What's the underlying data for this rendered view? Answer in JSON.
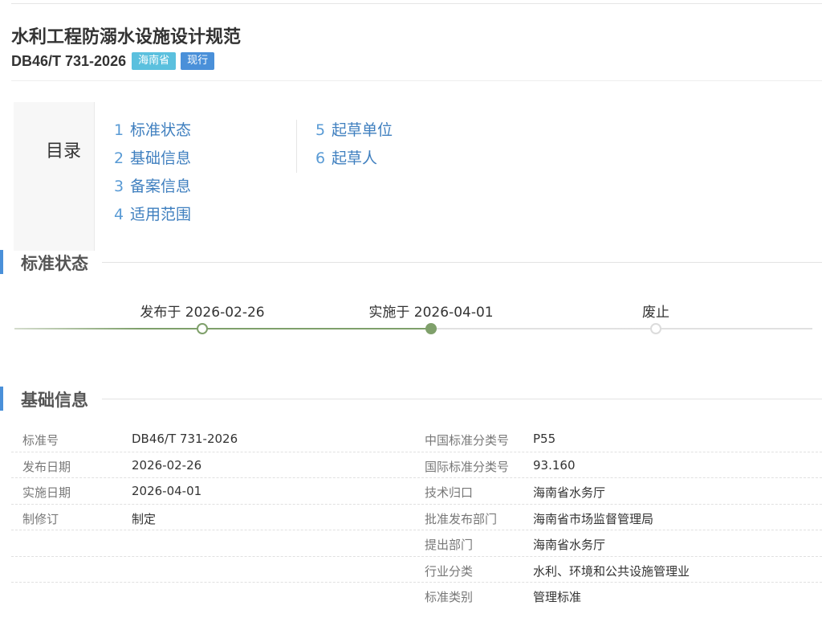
{
  "header": {
    "title": "水利工程防溺水设施设计规范",
    "code": "DB46/T 731-2026",
    "badges": {
      "region": "海南省",
      "status": "现行"
    }
  },
  "toc": {
    "label": "目录",
    "items": [
      {
        "num": "1",
        "label": "标准状态"
      },
      {
        "num": "2",
        "label": "基础信息"
      },
      {
        "num": "3",
        "label": "备案信息"
      },
      {
        "num": "4",
        "label": "适用范围"
      },
      {
        "num": "5",
        "label": "起草单位"
      },
      {
        "num": "6",
        "label": "起草人"
      }
    ]
  },
  "status_section": {
    "title": "标准状态",
    "timeline": [
      {
        "label": "发布于 2026-02-26",
        "state": "passed"
      },
      {
        "label": "实施于 2026-04-01",
        "state": "current"
      },
      {
        "label": "废止",
        "state": "pending"
      }
    ]
  },
  "basic_section": {
    "title": "基础信息",
    "left": [
      {
        "label": "标准号",
        "value": "DB46/T 731-2026"
      },
      {
        "label": "发布日期",
        "value": "2026-02-26"
      },
      {
        "label": "实施日期",
        "value": "2026-04-01"
      },
      {
        "label": "制修订",
        "value": "制定"
      }
    ],
    "right": [
      {
        "label": "中国标准分类号",
        "value": "P55"
      },
      {
        "label": "国际标准分类号",
        "value": "93.160"
      },
      {
        "label": "技术归口",
        "value": "海南省水务厅"
      },
      {
        "label": "批准发布部门",
        "value": "海南省市场监督管理局"
      },
      {
        "label": "提出部门",
        "value": "海南省水务厅"
      },
      {
        "label": "行业分类",
        "value": "水利、环境和公共设施管理业"
      },
      {
        "label": "标准类别",
        "value": "管理标准"
      }
    ]
  },
  "colors": {
    "accent": "#4a90d9",
    "region_badge": "#5bc0de",
    "timeline_green": "#7fa06b",
    "link": "#3f7fbf"
  }
}
